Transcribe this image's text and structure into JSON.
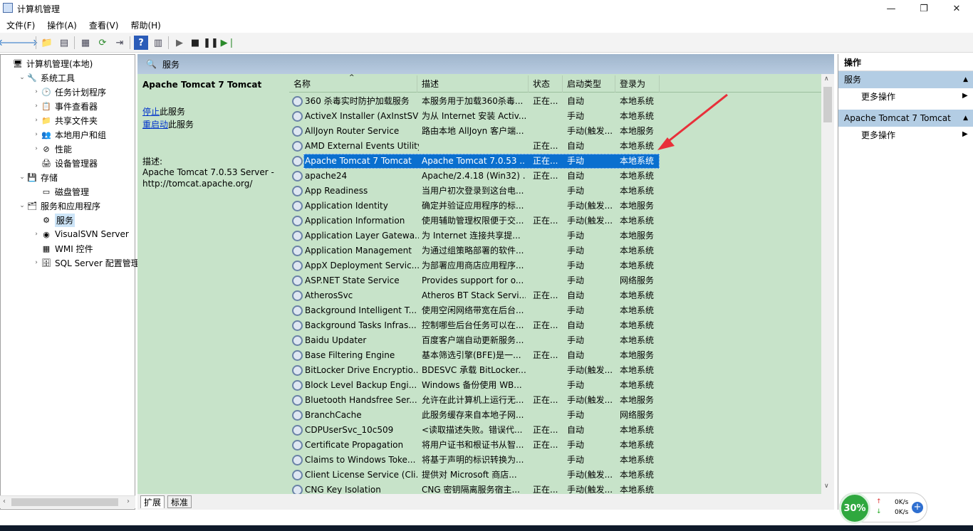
{
  "window": {
    "title": "计算机管理",
    "min": "—",
    "max": "❐",
    "close": "✕"
  },
  "menu": [
    "文件(F)",
    "操作(A)",
    "查看(V)",
    "帮助(H)"
  ],
  "tree": [
    {
      "label": "计算机管理(本地)",
      "icon": "computer-icon",
      "glyph": "🖥",
      "level": 0,
      "exp": ""
    },
    {
      "label": "系统工具",
      "icon": "tools-icon",
      "glyph": "🔧",
      "level": 1,
      "exp": "⌄"
    },
    {
      "label": "任务计划程序",
      "icon": "clock-icon",
      "glyph": "🕑",
      "level": 2,
      "exp": "›"
    },
    {
      "label": "事件查看器",
      "icon": "event-viewer-icon",
      "glyph": "📋",
      "level": 2,
      "exp": "›"
    },
    {
      "label": "共享文件夹",
      "icon": "shared-folder-icon",
      "glyph": "📁",
      "level": 2,
      "exp": "›"
    },
    {
      "label": "本地用户和组",
      "icon": "users-icon",
      "glyph": "👥",
      "level": 2,
      "exp": "›"
    },
    {
      "label": "性能",
      "icon": "performance-icon",
      "glyph": "⊘",
      "level": 2,
      "exp": "›"
    },
    {
      "label": "设备管理器",
      "icon": "device-manager-icon",
      "glyph": "🖨",
      "level": 2,
      "exp": ""
    },
    {
      "label": "存储",
      "icon": "storage-icon",
      "glyph": "💾",
      "level": 1,
      "exp": "⌄"
    },
    {
      "label": "磁盘管理",
      "icon": "disk-icon",
      "glyph": "▭",
      "level": 2,
      "exp": ""
    },
    {
      "label": "服务和应用程序",
      "icon": "services-apps-icon",
      "glyph": "🗂",
      "level": 1,
      "exp": "⌄"
    },
    {
      "label": "服务",
      "icon": "gear-icon",
      "glyph": "⚙",
      "level": 2,
      "exp": "",
      "selected": true
    },
    {
      "label": "VisualSVN Server",
      "icon": "visualsvn-icon",
      "glyph": "◉",
      "level": 2,
      "exp": "›"
    },
    {
      "label": "WMI 控件",
      "icon": "wmi-icon",
      "glyph": "▦",
      "level": 2,
      "exp": ""
    },
    {
      "label": "SQL Server 配置管理器",
      "icon": "sql-server-icon",
      "glyph": "🗄",
      "level": 2,
      "exp": "›"
    }
  ],
  "center": {
    "header": "服务",
    "service_name": "Apache Tomcat 7 Tomcat",
    "stop_link": "停止",
    "stop_rest": "此服务",
    "restart_link": "重启动",
    "restart_rest": "此服务",
    "desc_label": "描述:",
    "desc_text": "Apache Tomcat 7.0.53 Server - http://tomcat.apache.org/"
  },
  "columns": [
    "名称",
    "描述",
    "状态",
    "启动类型",
    "登录为"
  ],
  "rows": [
    [
      "360 杀毒实时防护加载服务",
      "本服务用于加载360杀毒...",
      "正在...",
      "自动",
      "本地系统"
    ],
    [
      "ActiveX Installer (AxInstSV)",
      "为从 Internet 安装 Activ...",
      "",
      "手动",
      "本地系统"
    ],
    [
      "AllJoyn Router Service",
      "路由本地 AllJoyn 客户端...",
      "",
      "手动(触发...",
      "本地服务"
    ],
    [
      "AMD External Events Utility",
      "",
      "正在...",
      "自动",
      "本地系统"
    ],
    [
      "Apache Tomcat 7 Tomcat",
      "Apache Tomcat 7.0.53 ...",
      "正在...",
      "手动",
      "本地系统"
    ],
    [
      "apache24",
      "Apache/2.4.18 (Win32) ...",
      "正在...",
      "自动",
      "本地系统"
    ],
    [
      "App Readiness",
      "当用户初次登录到这台电...",
      "",
      "手动",
      "本地系统"
    ],
    [
      "Application Identity",
      "确定并验证应用程序的标...",
      "",
      "手动(触发...",
      "本地服务"
    ],
    [
      "Application Information",
      "使用辅助管理权限便于交...",
      "正在...",
      "手动(触发...",
      "本地系统"
    ],
    [
      "Application Layer Gatewa...",
      "为 Internet 连接共享提...",
      "",
      "手动",
      "本地服务"
    ],
    [
      "Application Management",
      "为通过组策略部署的软件...",
      "",
      "手动",
      "本地系统"
    ],
    [
      "AppX Deployment Servic...",
      "为部署应用商店应用程序...",
      "",
      "手动",
      "本地系统"
    ],
    [
      "ASP.NET State Service",
      "Provides support for o...",
      "",
      "手动",
      "网络服务"
    ],
    [
      "AtherosSvc",
      "Atheros BT Stack Servi...",
      "正在...",
      "自动",
      "本地系统"
    ],
    [
      "Background Intelligent T...",
      "使用空闲网络带宽在后台...",
      "",
      "手动",
      "本地系统"
    ],
    [
      "Background Tasks Infras...",
      "控制哪些后台任务可以在...",
      "正在...",
      "自动",
      "本地系统"
    ],
    [
      "Baidu Updater",
      "百度客户端自动更新服务...",
      "",
      "手动",
      "本地系统"
    ],
    [
      "Base Filtering Engine",
      "基本筛选引擎(BFE)是一...",
      "正在...",
      "自动",
      "本地服务"
    ],
    [
      "BitLocker Drive Encryptio...",
      "BDESVC 承载 BitLocker...",
      "",
      "手动(触发...",
      "本地系统"
    ],
    [
      "Block Level Backup Engi...",
      "Windows 备份使用 WB...",
      "",
      "手动",
      "本地系统"
    ],
    [
      "Bluetooth Handsfree Ser...",
      "允许在此计算机上运行无...",
      "正在...",
      "手动(触发...",
      "本地服务"
    ],
    [
      "BranchCache",
      "此服务缓存来自本地子网...",
      "",
      "手动",
      "网络服务"
    ],
    [
      "CDPUserSvc_10c509",
      "<读取描述失败。错误代...",
      "正在...",
      "自动",
      "本地系统"
    ],
    [
      "Certificate Propagation",
      "将用户证书和根证书从智...",
      "正在...",
      "手动",
      "本地系统"
    ],
    [
      "Claims to Windows Toke...",
      "将基于声明的标识转换为...",
      "",
      "手动",
      "本地系统"
    ],
    [
      "Client License Service (Cli...",
      "提供对 Microsoft 商店...",
      "",
      "手动(触发...",
      "本地系统"
    ],
    [
      "CNG Key Isolation",
      "CNG 密钥隔离服务宿主...",
      "正在...",
      "手动(触发...",
      "本地系统"
    ]
  ],
  "selected_row": 4,
  "tabs": [
    "扩展",
    "标准"
  ],
  "actions": {
    "title": "操作",
    "sections": [
      {
        "header": "服务",
        "item": "更多操作"
      },
      {
        "header": "Apache Tomcat 7 Tomcat",
        "item": "更多操作"
      }
    ]
  },
  "net": {
    "percent": "30%",
    "up": "0K/s",
    "down": "0K/s"
  },
  "colors": {
    "selection": "#0a6fcf",
    "list_bg": "#c7e3c9",
    "arrow": "#e8303a"
  }
}
